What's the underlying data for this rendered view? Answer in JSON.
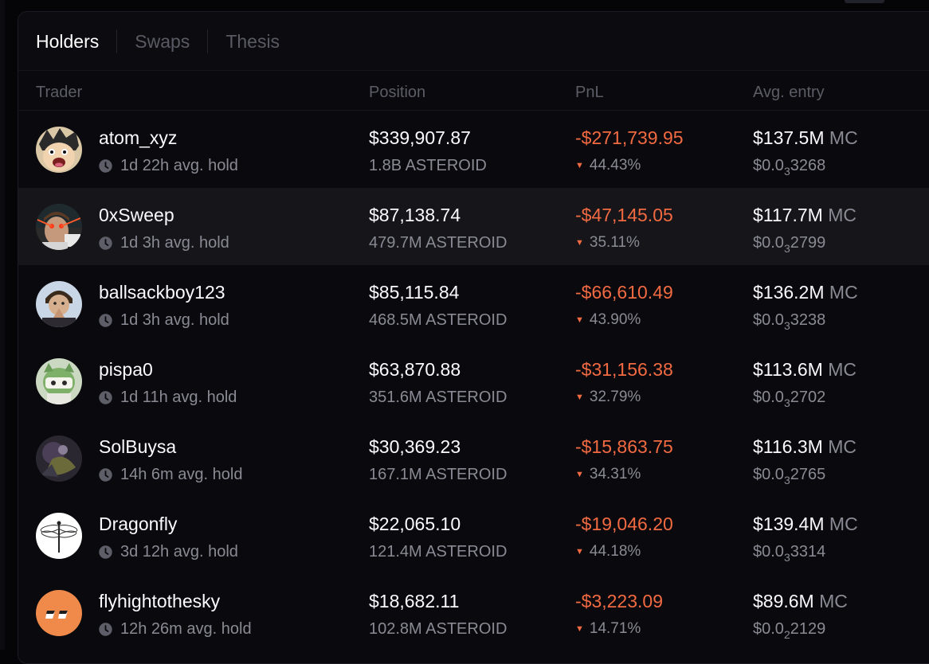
{
  "tabs": [
    {
      "label": "Holders",
      "active": true
    },
    {
      "label": "Swaps",
      "active": false
    },
    {
      "label": "Thesis",
      "active": false
    }
  ],
  "columns": {
    "trader": "Trader",
    "position": "Position",
    "pnl": "PnL",
    "avg_entry": "Avg. entry"
  },
  "rows": [
    {
      "name": "atom_xyz",
      "hold": "1d 22h avg. hold",
      "position": "$339,907.87",
      "tokens": "1.8B ASTEROID",
      "pnl": "-$271,739.95",
      "pnl_pct": "44.43%",
      "avg_mc": "$137.5M",
      "mc_label": "MC",
      "price_prefix": "$0.0",
      "price_sub": "3",
      "price_rest": "3268",
      "avatar": "cartoon-boy",
      "highlight": false
    },
    {
      "name": "0xSweep",
      "hold": "1d 3h avg. hold",
      "position": "$87,138.74",
      "tokens": "479.7M ASTEROID",
      "pnl": "-$47,145.05",
      "pnl_pct": "35.11%",
      "avg_mc": "$117.7M",
      "mc_label": "MC",
      "price_prefix": "$0.0",
      "price_sub": "3",
      "price_rest": "2799",
      "avatar": "laser-eyes",
      "highlight": true
    },
    {
      "name": "ballsackboy123",
      "hold": "1d 3h avg. hold",
      "position": "$85,115.84",
      "tokens": "468.5M ASTEROID",
      "pnl": "-$66,610.49",
      "pnl_pct": "43.90%",
      "avg_mc": "$136.2M",
      "mc_label": "MC",
      "price_prefix": "$0.0",
      "price_sub": "3",
      "price_rest": "3238",
      "avatar": "praying-kid",
      "highlight": false
    },
    {
      "name": "pispa0",
      "hold": "1d 11h avg. hold",
      "position": "$63,870.88",
      "tokens": "351.6M ASTEROID",
      "pnl": "-$31,156.38",
      "pnl_pct": "32.79%",
      "avg_mc": "$113.6M",
      "mc_label": "MC",
      "price_prefix": "$0.0",
      "price_sub": "3",
      "price_rest": "2702",
      "avatar": "green-creature",
      "highlight": false
    },
    {
      "name": "SolBuysa",
      "hold": "14h 6m avg. hold",
      "position": "$30,369.23",
      "tokens": "167.1M ASTEROID",
      "pnl": "-$15,863.75",
      "pnl_pct": "34.31%",
      "avg_mc": "$116.3M",
      "mc_label": "MC",
      "price_prefix": "$0.0",
      "price_sub": "3",
      "price_rest": "2765",
      "avatar": "dark-art",
      "highlight": false
    },
    {
      "name": "Dragonfly",
      "hold": "3d 12h avg. hold",
      "position": "$22,065.10",
      "tokens": "121.4M ASTEROID",
      "pnl": "-$19,046.20",
      "pnl_pct": "44.18%",
      "avg_mc": "$139.4M",
      "mc_label": "MC",
      "price_prefix": "$0.0",
      "price_sub": "3",
      "price_rest": "3314",
      "avatar": "dragonfly-sketch",
      "highlight": false
    },
    {
      "name": "flyhightothesky",
      "hold": "12h 26m avg. hold",
      "position": "$18,682.11",
      "tokens": "102.8M ASTEROID",
      "pnl": "-$3,223.09",
      "pnl_pct": "14.71%",
      "avg_mc": "$89.6M",
      "mc_label": "MC",
      "price_prefix": "$0.0",
      "price_sub": "2",
      "price_rest": "2129",
      "avatar": "orange-quote",
      "highlight": false
    }
  ]
}
